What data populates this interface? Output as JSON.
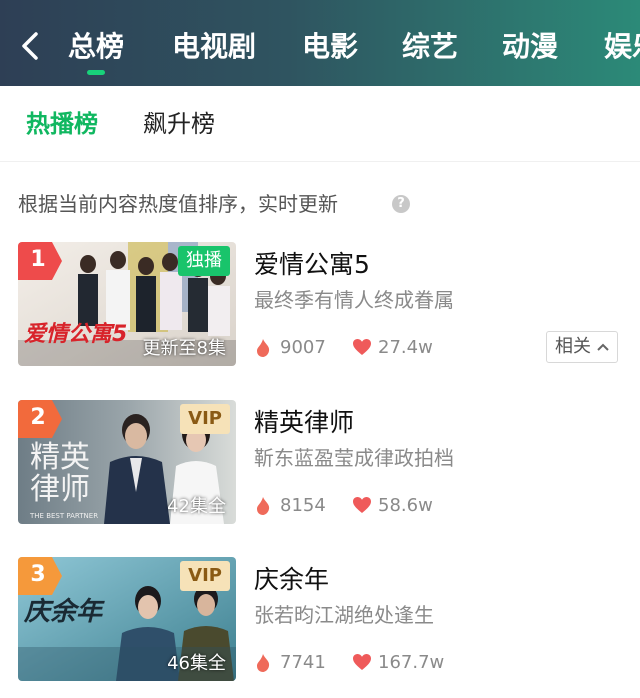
{
  "header": {
    "categories": [
      {
        "label": "总榜",
        "active": true
      },
      {
        "label": "电视剧"
      },
      {
        "label": "电影"
      },
      {
        "label": "综艺"
      },
      {
        "label": "动漫"
      },
      {
        "label": "娱乐"
      }
    ],
    "back_icon": "chevron-left-icon",
    "active_underline_color": "#18d27a"
  },
  "subtabs": [
    {
      "label": "热播榜",
      "active": true
    },
    {
      "label": "飙升榜"
    }
  ],
  "note": "根据当前内容热度值排序，实时更新",
  "note_icon": "question-mark-icon",
  "accent_color": "#10b760",
  "items": [
    {
      "rank": "1",
      "rank_color": "#ee4b4b",
      "title": "爱情公寓5",
      "subtitle": "最终季有情人终成眷属",
      "badge": "独播",
      "badge_type": "exclusive",
      "poster_text": "爱情公寓5",
      "episodes": "更新至8集",
      "heat": "9007",
      "likes": "27.4w",
      "related_label": "相关"
    },
    {
      "rank": "2",
      "rank_color": "#f26a3c",
      "title": "精英律师",
      "subtitle": "靳东蓝盈莹成律政拍档",
      "badge": "VIP",
      "badge_type": "vip",
      "poster_text": "精英律师",
      "poster_subtext": "THE BEST PARTNER",
      "episodes": "42集全",
      "heat": "8154",
      "likes": "58.6w"
    },
    {
      "rank": "3",
      "rank_color": "#f5993b",
      "title": "庆余年",
      "subtitle": "张若昀江湖绝处逢生",
      "badge": "VIP",
      "badge_type": "vip",
      "poster_text": "庆余年",
      "episodes": "46集全",
      "heat": "7741",
      "likes": "167.7w"
    }
  ]
}
